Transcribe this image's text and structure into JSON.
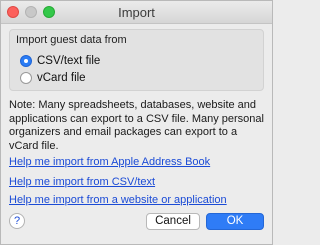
{
  "window": {
    "title": "Import"
  },
  "group": {
    "label": "Import guest data from",
    "options": [
      {
        "label": "CSV/text file",
        "selected": true
      },
      {
        "label": "vCard file",
        "selected": false
      }
    ]
  },
  "note": "Note: Many spreadsheets, databases, website and applications can export to a CSV file. Many personal organizers and email packages can export to a vCard file.",
  "links": [
    "Help me import from Apple Address Book",
    "Help me import from CSV/text",
    "Help me import from a website or application"
  ],
  "help_icon": "?",
  "buttons": {
    "cancel": "Cancel",
    "ok": "OK"
  },
  "colors": {
    "accent": "#2f7cf6",
    "link": "#1b4bd6",
    "close": "#fc605c",
    "maximize": "#34c84a"
  }
}
